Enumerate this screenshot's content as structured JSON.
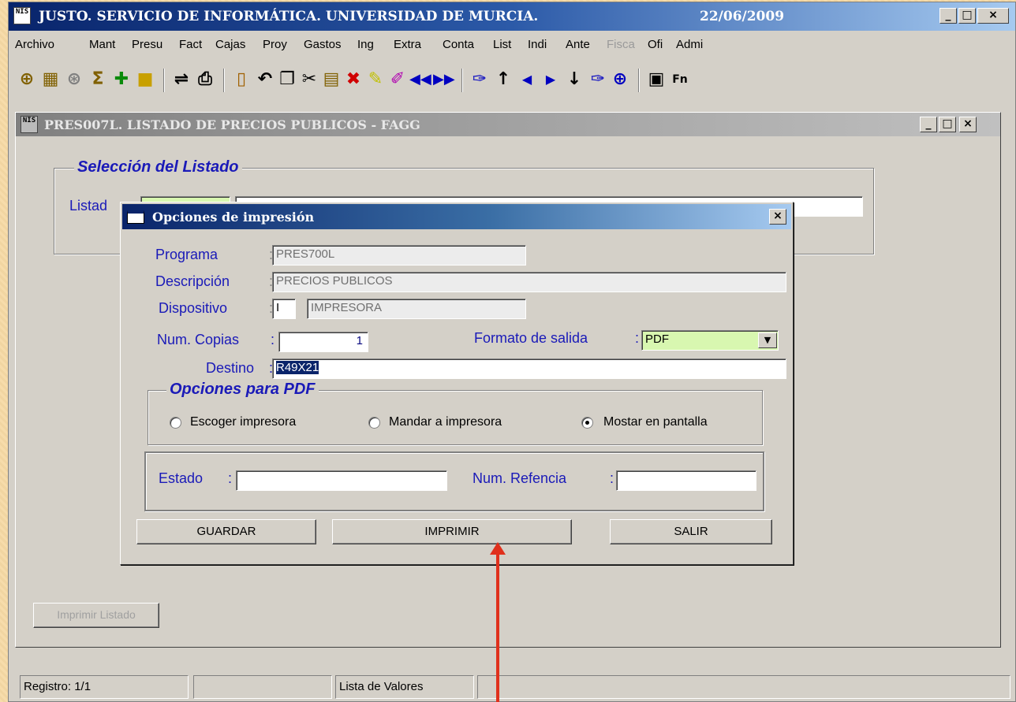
{
  "app": {
    "title": "JUSTO. SERVICIO DE INFORMÁTICA. UNIVERSIDAD DE MURCIA.",
    "date": "22/06/2009",
    "icon_text": "NIS",
    "minimize": "_",
    "maximize": "□",
    "close": "×"
  },
  "menu": [
    "Archivo",
    "Mant",
    "Presu",
    "Fact",
    "Cajas",
    "Proy",
    "Gastos",
    "Ing",
    "Extra",
    "Conta",
    "List",
    "Indi",
    "Ante",
    "Fisca",
    "Ofi",
    "Admi"
  ],
  "toolbar_icons": [
    "query-icon",
    "table-query-icon",
    "count-icon",
    "sum-icon",
    "insert-icon",
    "save-icon",
    "sort-icon",
    "print-icon",
    "exit-icon",
    "undo-icon",
    "copy-icon",
    "cut-icon",
    "paste-icon",
    "delete-icon",
    "clear-icon",
    "clear-record-icon",
    "first-record-icon",
    "last-record-icon",
    "edit-icon",
    "up-icon",
    "prev-icon",
    "next-icon",
    "down-icon",
    "search-icon",
    "zoom-icon",
    "clipboard-icon",
    "function-key-icon"
  ],
  "child": {
    "title": "PRES007L. LISTADO DE PRECIOS PUBLICOS - FAGG",
    "group_title": "Selección del Listado",
    "listado_label": "Listad",
    "print_button": "Imprimir Listado"
  },
  "dialog": {
    "title": "Opciones de impresión",
    "close": "×",
    "programa_label": "Programa",
    "programa_value": "PRES700L",
    "descripcion_label": "Descripción",
    "descripcion_value": "PRECIOS PUBLICOS",
    "dispositivo_label": "Dispositivo",
    "dispositivo_code": "I",
    "dispositivo_value": "IMPRESORA",
    "copias_label": "Num. Copias",
    "copias_value": "1",
    "formato_label": "Formato de salida",
    "formato_value": "PDF",
    "destino_label": "Destino",
    "destino_value": "R49X21",
    "pdf_group_title": "Opciones para PDF",
    "radio_options": [
      {
        "label": "Escoger impresora",
        "checked": false
      },
      {
        "label": "Mandar a impresora",
        "checked": false
      },
      {
        "label": "Mostar en pantalla",
        "checked": true
      }
    ],
    "estado_label": "Estado",
    "estado_value": "",
    "refencia_label": "Num. Refencia",
    "refencia_value": "",
    "buttons": {
      "guardar": "GUARDAR",
      "imprimir": "IMPRIMIR",
      "salir": "SALIR"
    }
  },
  "status": {
    "registro": "Registro: 1/1",
    "panel2": "",
    "lista": "Lista de Valores",
    "panel4": ""
  },
  "colors": {
    "label_blue": "#1a1ab8",
    "title_blue": "#0a246a",
    "arrow_red": "#e0301c",
    "field_green": "#d8f7b0"
  }
}
